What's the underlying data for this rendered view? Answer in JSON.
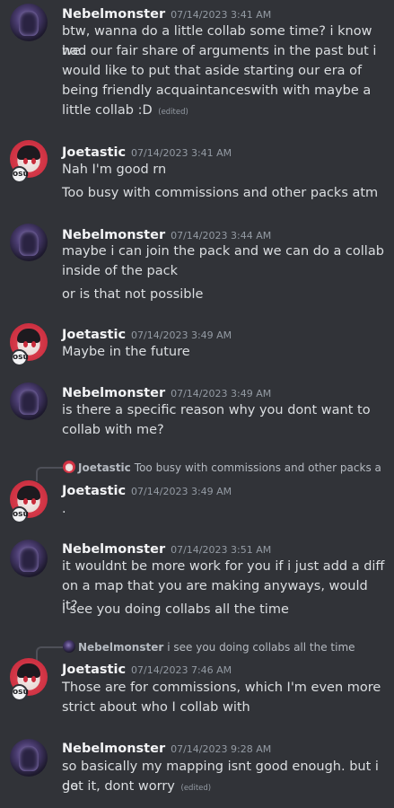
{
  "messages": [
    {
      "author": "Nebelmonster",
      "timestamp": "07/14/2023 3:41 AM",
      "lines": [
        "btw, wanna do a little collab some time? i know we",
        "had our fair share of arguments in the past but i",
        "would like to put that aside starting our era of",
        "being friendly acquaintanceswith with maybe a",
        "little collab :D"
      ],
      "edited": "(edited)"
    },
    {
      "author": "Joetastic",
      "timestamp": "07/14/2023 3:41 AM",
      "lines": [
        "Nah I'm good rn",
        "Too busy with commissions and other packs atm"
      ]
    },
    {
      "author": "Nebelmonster",
      "timestamp": "07/14/2023 3:44 AM",
      "lines": [
        "maybe i can join the pack and we can do a collab",
        "inside of the pack",
        "or is that not possible"
      ]
    },
    {
      "author": "Joetastic",
      "timestamp": "07/14/2023 3:49 AM",
      "lines": [
        "Maybe in the future"
      ]
    },
    {
      "author": "Nebelmonster",
      "timestamp": "07/14/2023 3:49 AM",
      "lines": [
        "is there a specific reason why you dont want to",
        "collab with me?"
      ]
    },
    {
      "author": "Joetastic",
      "timestamp": "07/14/2023 3:49 AM",
      "lines": [
        "."
      ],
      "reply": {
        "author": "Joetastic",
        "text": "Too busy with commissions and other packs a"
      }
    },
    {
      "author": "Nebelmonster",
      "timestamp": "07/14/2023 3:51 AM",
      "lines": [
        "it wouldnt be more work for you if i just add a diff",
        "on a map that you are making anyways, would it?",
        "i see you doing collabs all the time"
      ]
    },
    {
      "author": "Joetastic",
      "timestamp": "07/14/2023 7:46 AM",
      "lines": [
        "Those are for commissions, which I'm even more",
        "strict about who I collab with"
      ],
      "reply": {
        "author": "Nebelmonster",
        "text": "i see you doing collabs all the time"
      }
    },
    {
      "author": "Nebelmonster",
      "timestamp": "07/14/2023 9:28 AM",
      "lines": [
        "so basically my mapping isnt good enough. but i do",
        "get it, dont worry"
      ],
      "edited": "(edited)"
    }
  ],
  "colors": {
    "background": "#313338",
    "username": "#f2f3f5",
    "timestamp": "#949ba4",
    "text": "#dbdee1",
    "joe_accent": "#d63a4a",
    "nebel_accent": "#8a78b8"
  },
  "icons": {
    "nebel_avatar": "purple-monster-avatar",
    "joe_avatar": "anime-girl-avatar",
    "badge": "osu-badge"
  },
  "badge_text": "osu"
}
